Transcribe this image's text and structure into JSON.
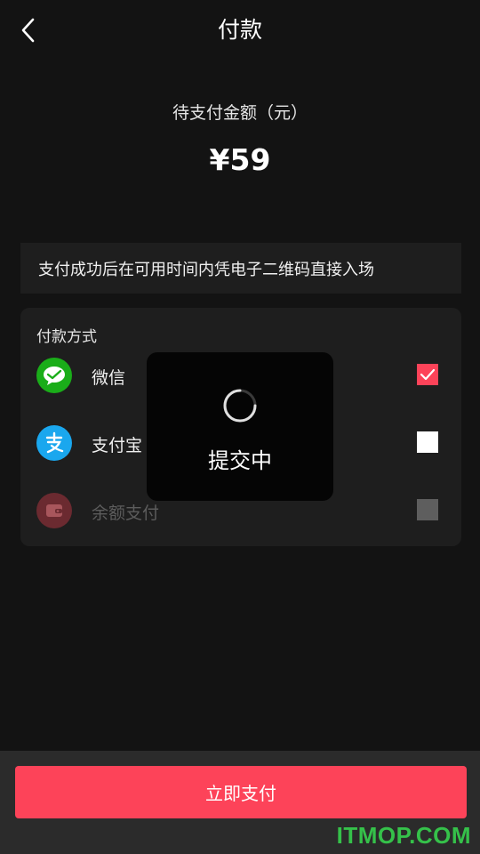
{
  "header": {
    "title": "付款"
  },
  "amount": {
    "label": "待支付金额（元）",
    "value": "¥59"
  },
  "notice": "支付成功后在可用时间内凭电子二维码直接入场",
  "payment": {
    "title": "付款方式",
    "methods": [
      {
        "label": "微信",
        "icon": "wechat-icon",
        "checked": true,
        "disabled": false
      },
      {
        "label": "支付宝",
        "icon": "alipay-icon",
        "checked": false,
        "disabled": false
      },
      {
        "label": "余额支付",
        "icon": "wallet-icon",
        "checked": false,
        "disabled": true
      }
    ]
  },
  "loading": {
    "text": "提交中"
  },
  "footer": {
    "pay_button": "立即支付"
  },
  "watermark": "ITMOP.COM",
  "colors": {
    "accent": "#fd4359",
    "background": "#131313",
    "card": "#1e1e1e",
    "wechat": "#1aad19",
    "alipay": "#1aa7ee"
  }
}
